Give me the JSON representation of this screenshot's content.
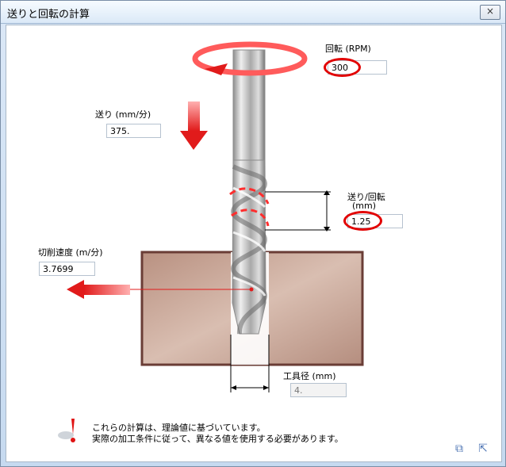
{
  "window": {
    "title": "送りと回転の計算",
    "close_label": "×"
  },
  "fields": {
    "rpm": {
      "label": "回転 (RPM)",
      "value": "300"
    },
    "feed": {
      "label": "送り (mm/分)",
      "value": "375."
    },
    "per_rev": {
      "label_line1": "送り/回転",
      "label_line2": "(mm)",
      "value": "1.25"
    },
    "cutting_speed": {
      "label": "切削速度 (m/分)",
      "value": "3.7699"
    },
    "diameter": {
      "label": "工具径 (mm)",
      "value": "4."
    }
  },
  "note": {
    "line1": "これらの計算は、理論値に基づいています。",
    "line2": "実際の加工条件に従って、異なる値を使用する必要があります。"
  },
  "icons": {
    "warning": "warning-icon",
    "copy": "copy-icon",
    "export": "export-icon"
  }
}
